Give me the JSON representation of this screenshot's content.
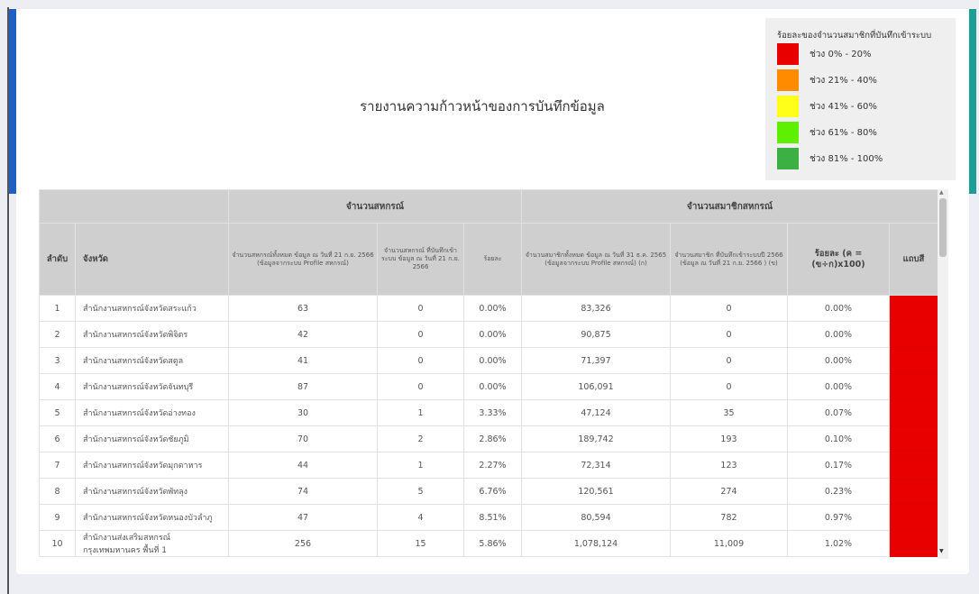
{
  "report": {
    "title": "รายงานความก้าวหน้าของการบันทึกข้อมูล"
  },
  "legend": {
    "title": "ร้อยละของจำนวนสมาชิกที่บันทึกเข้าระบบ",
    "items": [
      {
        "label": "ช่วง 0% - 20%",
        "color": "#e80000"
      },
      {
        "label": "ช่วง 21% - 40%",
        "color": "#ff8c00"
      },
      {
        "label": "ช่วง 41% - 60%",
        "color": "#ffff1a"
      },
      {
        "label": "ช่วง 61% - 80%",
        "color": "#5ef000"
      },
      {
        "label": "ช่วง 81% - 100%",
        "color": "#3cb043"
      }
    ]
  },
  "table": {
    "group_headers": {
      "coops": "จำนวนสหกรณ์",
      "members": "จำนวนสมาชิกสหกรณ์"
    },
    "headers": {
      "no": "ลำดับ",
      "province": "จังหวัด",
      "coop_total": "จำนวนสหกรณ์ทั้งหมด ข้อมูล ณ วันที่ 21 ก.ย. 2566 (ข้อมูลจากระบบ Profile สหกรณ์)",
      "coop_recorded": "จำนวนสหกรณ์ ที่บันทึกเข้าระบบ ข้อมูล ณ วันที่ 21 ก.ย. 2566",
      "coop_pct": "ร้อยละ",
      "member_total": "จำนวนสมาชิกทั้งหมด ข้อมูล ณ วันที่ 31 ธ.ค. 2565 (ข้อมูลจากระบบ Profile สหกรณ์) (ก)",
      "member_recorded": "จำนวนสมาชิก ที่บันทึกเข้าระบบปี 2566 (ข้อมูล ณ วันที่ 21 ก.ย. 2566 ) (ข)",
      "member_pct": "ร้อยละ (ค = (ข÷ก)x100)",
      "color": "แถบสี"
    },
    "rows": [
      {
        "no": "1",
        "name": "สำนักงานสหกรณ์จังหวัดสระแก้ว",
        "coop_total": "63",
        "coop_recorded": "0",
        "coop_pct": "0.00%",
        "member_total": "83,326",
        "member_recorded": "0",
        "member_pct": "0.00%",
        "color": "#e80000"
      },
      {
        "no": "2",
        "name": "สำนักงานสหกรณ์จังหวัดพิจิตร",
        "coop_total": "42",
        "coop_recorded": "0",
        "coop_pct": "0.00%",
        "member_total": "90,875",
        "member_recorded": "0",
        "member_pct": "0.00%",
        "color": "#e80000"
      },
      {
        "no": "3",
        "name": "สำนักงานสหกรณ์จังหวัดสตูล",
        "coop_total": "41",
        "coop_recorded": "0",
        "coop_pct": "0.00%",
        "member_total": "71,397",
        "member_recorded": "0",
        "member_pct": "0.00%",
        "color": "#e80000"
      },
      {
        "no": "4",
        "name": "สำนักงานสหกรณ์จังหวัดจันทบุรี",
        "coop_total": "87",
        "coop_recorded": "0",
        "coop_pct": "0.00%",
        "member_total": "106,091",
        "member_recorded": "0",
        "member_pct": "0.00%",
        "color": "#e80000"
      },
      {
        "no": "5",
        "name": "สำนักงานสหกรณ์จังหวัดอ่างทอง",
        "coop_total": "30",
        "coop_recorded": "1",
        "coop_pct": "3.33%",
        "member_total": "47,124",
        "member_recorded": "35",
        "member_pct": "0.07%",
        "color": "#e80000"
      },
      {
        "no": "6",
        "name": "สำนักงานสหกรณ์จังหวัดชัยภูมิ",
        "coop_total": "70",
        "coop_recorded": "2",
        "coop_pct": "2.86%",
        "member_total": "189,742",
        "member_recorded": "193",
        "member_pct": "0.10%",
        "color": "#e80000"
      },
      {
        "no": "7",
        "name": "สำนักงานสหกรณ์จังหวัดมุกดาหาร",
        "coop_total": "44",
        "coop_recorded": "1",
        "coop_pct": "2.27%",
        "member_total": "72,314",
        "member_recorded": "123",
        "member_pct": "0.17%",
        "color": "#e80000"
      },
      {
        "no": "8",
        "name": "สำนักงานสหกรณ์จังหวัดพัทลุง",
        "coop_total": "74",
        "coop_recorded": "5",
        "coop_pct": "6.76%",
        "member_total": "120,561",
        "member_recorded": "274",
        "member_pct": "0.23%",
        "color": "#e80000"
      },
      {
        "no": "9",
        "name": "สำนักงานสหกรณ์จังหวัดหนองบัวลำภู",
        "coop_total": "47",
        "coop_recorded": "4",
        "coop_pct": "8.51%",
        "member_total": "80,594",
        "member_recorded": "782",
        "member_pct": "0.97%",
        "color": "#e80000"
      },
      {
        "no": "10",
        "name": "สำนักงานส่งเสริมสหกรณ์ กรุงเทพมหานคร พื้นที่ 1",
        "coop_total": "256",
        "coop_recorded": "15",
        "coop_pct": "5.86%",
        "member_total": "1,078,124",
        "member_recorded": "11,009",
        "member_pct": "1.02%",
        "color": "#e80000"
      }
    ]
  }
}
